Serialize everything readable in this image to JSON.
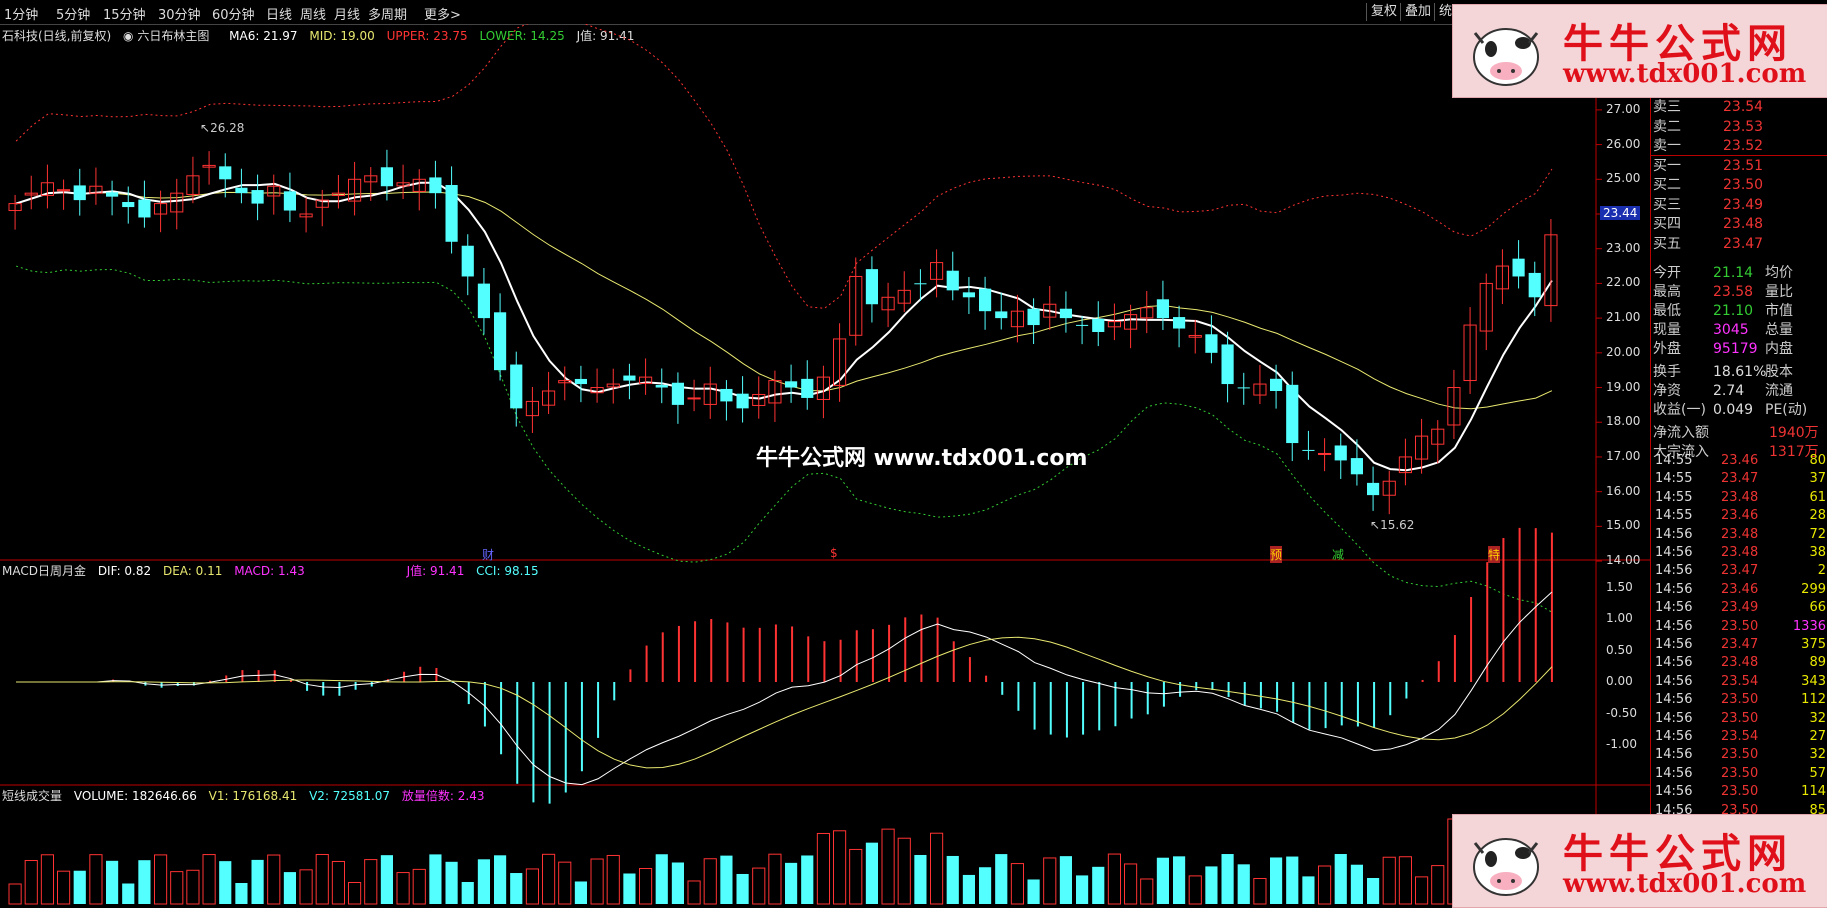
{
  "menu": {
    "items": [
      "1分钟",
      "5分钟",
      "15分钟",
      "30分钟",
      "60分钟",
      "日线",
      "周线",
      "月线",
      "多周期",
      "更多>"
    ],
    "right_buttons": [
      "复权",
      "叠加",
      "统"
    ]
  },
  "main_legend": {
    "title": "石科技(日线,前复权)",
    "indicator": "六日布林主图",
    "ma6": "MA6: 21.97",
    "mid": "MID: 19.00",
    "upper": "UPPER: 23.75",
    "lower": "LOWER: 14.25",
    "jval": "J值: 91.41"
  },
  "macd_legend": {
    "title": "MACD日周月金",
    "dif": "DIF: 0.82",
    "dea": "DEA: 0.11",
    "macd": "MACD: 1.43",
    "jval": "J值: 91.41",
    "cci": "CCI: 98.15"
  },
  "vol_legend": {
    "title": "短线成交量",
    "volume": "VOLUME: 182646.66",
    "v1": "V1: 176168.41",
    "v2": "V2: 72581.07",
    "ratio": "放量倍数: 2.43"
  },
  "price_axis": [
    "27.00",
    "26.00",
    "25.00",
    "24.00",
    "23.00",
    "22.00",
    "21.00",
    "20.00",
    "19.00",
    "18.00",
    "17.00",
    "16.00",
    "15.00",
    "14.00"
  ],
  "current_price_tag": "23.44",
  "macd_axis": [
    "1.50",
    "1.00",
    "0.50",
    "0.00",
    "-0.50",
    "-1.00"
  ],
  "annotations": {
    "high": "26.28",
    "low": "15.62",
    "center_watermark": "牛牛公式网 www.tdx001.com"
  },
  "event_markers": [
    "财",
    "$",
    "预",
    "减",
    "特"
  ],
  "order_book": [
    {
      "label": "卖三",
      "value": "23.54"
    },
    {
      "label": "卖二",
      "value": "23.53"
    },
    {
      "label": "卖一",
      "value": "23.52"
    },
    {
      "label": "买一",
      "value": "23.51"
    },
    {
      "label": "买二",
      "value": "23.50"
    },
    {
      "label": "买三",
      "value": "23.49"
    },
    {
      "label": "买四",
      "value": "23.48"
    },
    {
      "label": "买五",
      "value": "23.47"
    }
  ],
  "quote_stats": [
    {
      "label": "今开",
      "value": "21.14",
      "label2": "均价"
    },
    {
      "label": "最高",
      "value": "23.58",
      "label2": "量比"
    },
    {
      "label": "最低",
      "value": "21.10",
      "label2": "市值"
    },
    {
      "label": "现量",
      "value": "3045",
      "label2": "总量"
    },
    {
      "label": "外盘",
      "value": "95179",
      "label2": "内盘"
    },
    {
      "label": "换手",
      "value": "18.61%",
      "label2": "股本"
    },
    {
      "label": "净资",
      "value": "2.74",
      "label2": "流通"
    },
    {
      "label": "收益(一)",
      "value": "0.049",
      "label2": "PE(动)"
    },
    {
      "label": "净流入额",
      "value": "1940万",
      "label2": ""
    },
    {
      "label": "大宗流入",
      "value": "1317万",
      "label2": ""
    }
  ],
  "ticks": [
    {
      "t": "14:55",
      "p": "23.46",
      "q": "80"
    },
    {
      "t": "14:55",
      "p": "23.47",
      "q": "37"
    },
    {
      "t": "14:55",
      "p": "23.48",
      "q": "61"
    },
    {
      "t": "14:55",
      "p": "23.46",
      "q": "28"
    },
    {
      "t": "14:56",
      "p": "23.48",
      "q": "72"
    },
    {
      "t": "14:56",
      "p": "23.48",
      "q": "38"
    },
    {
      "t": "14:56",
      "p": "23.47",
      "q": "2"
    },
    {
      "t": "14:56",
      "p": "23.46",
      "q": "299"
    },
    {
      "t": "14:56",
      "p": "23.49",
      "q": "66"
    },
    {
      "t": "14:56",
      "p": "23.50",
      "q": "1336"
    },
    {
      "t": "14:56",
      "p": "23.47",
      "q": "375"
    },
    {
      "t": "14:56",
      "p": "23.48",
      "q": "89"
    },
    {
      "t": "14:56",
      "p": "23.54",
      "q": "343"
    },
    {
      "t": "14:56",
      "p": "23.50",
      "q": "112"
    },
    {
      "t": "14:56",
      "p": "23.50",
      "q": "32"
    },
    {
      "t": "14:56",
      "p": "23.54",
      "q": "27"
    },
    {
      "t": "14:56",
      "p": "23.50",
      "q": "32"
    },
    {
      "t": "14:56",
      "p": "23.50",
      "q": "57"
    },
    {
      "t": "14:56",
      "p": "23.50",
      "q": "114"
    },
    {
      "t": "14:56",
      "p": "23.50",
      "q": "85"
    }
  ],
  "watermark": {
    "title": "牛牛公式网",
    "url": "www.tdx001.com"
  },
  "colors": {
    "up": "#ff3333",
    "down": "#54ffff",
    "ma": "#ffffff",
    "mid": "#e8e870",
    "upper": "#ff3333",
    "lower": "#33cc33",
    "highlight": "#ffcc00"
  }
}
